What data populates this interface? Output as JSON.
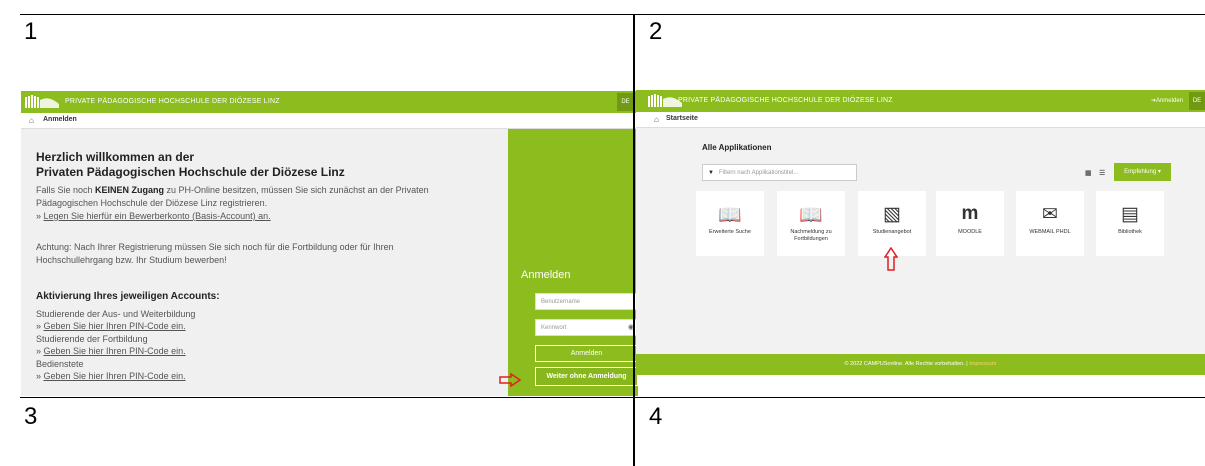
{
  "cells": {
    "one": "1",
    "two": "2",
    "three": "3",
    "four": "4"
  },
  "colors": {
    "brand_green": "#8cbc1e",
    "arrow_red": "#e02020"
  },
  "shot1": {
    "institution": "PRIVATE PÄDAGOGISCHE HOCHSCHULE DER DIÖZESE LINZ",
    "breadcrumb": "Anmelden",
    "lang": "DE",
    "welcome_line1": "Herzlich willkommen an der",
    "welcome_line2": "Privaten Pädagogischen Hochschule der Diözese Linz",
    "p1_pre": "Falls Sie noch ",
    "p1_bold": "KEINEN Zugang",
    "p1_post": " zu PH-Online besitzen, müssen Sie sich zunächst an der Privaten",
    "p1_line2": "Pädagogischen Hochschule der Diözese Linz registrieren.",
    "register_prefix": "» ",
    "register_link": "Legen Sie hierfür ein Bewerberkonto (Basis-Account) an.",
    "note_line1": "Achtung: Nach Ihrer Registrierung müssen Sie sich noch für die Fortbildung oder für Ihren",
    "note_line2": "Hochschullehrgang bzw. Ihr Studium bewerben!",
    "activation_heading": "Aktivierung Ihres jeweiligen Accounts:",
    "group1": "Studierende der Aus- und Weiterbildung",
    "group2": "Studierende der Fortbildung",
    "group3": "Bedienstete",
    "pin_prefix": "» ",
    "pin_link": "Geben Sie hier Ihren PIN-Code ein.",
    "login_title": "Anmelden",
    "username_placeholder": "Benutzername",
    "password_placeholder": "Kennwort",
    "login_button": "Anmelden",
    "guest_button": "Weiter ohne Anmeldung",
    "home_icon": "home-icon",
    "eye_icon": "eye-icon"
  },
  "shot2": {
    "institution": "PRIVATE PÄDAGOGISCHE HOCHSCHULE DER DIÖZESE LINZ",
    "login_link": "Anmelden",
    "lang": "DE",
    "breadcrumb": "Startseite",
    "section_title": "Alle Applikationen",
    "filter_placeholder": "Filtern nach Applikationstitel...",
    "recommend_button": "Empfehlung ▾",
    "tiles": [
      {
        "label": "Erweiterte Suche",
        "icon": "search-book-icon"
      },
      {
        "label": "Nachmeldung zu Fortbildungen",
        "icon": "search-book-icon"
      },
      {
        "label": "Studienangebot",
        "icon": "book-stack-icon"
      },
      {
        "label": "MOODLE",
        "icon": "moodle-icon"
      },
      {
        "label": "WEBMAIL PHDL",
        "icon": "mail-icon"
      },
      {
        "label": "Bibliothek",
        "icon": "library-icon"
      }
    ],
    "footer_text": "© 2022 CAMPUSonline. Alle Rechte vorbehalten. | ",
    "footer_link": "Impressum"
  }
}
